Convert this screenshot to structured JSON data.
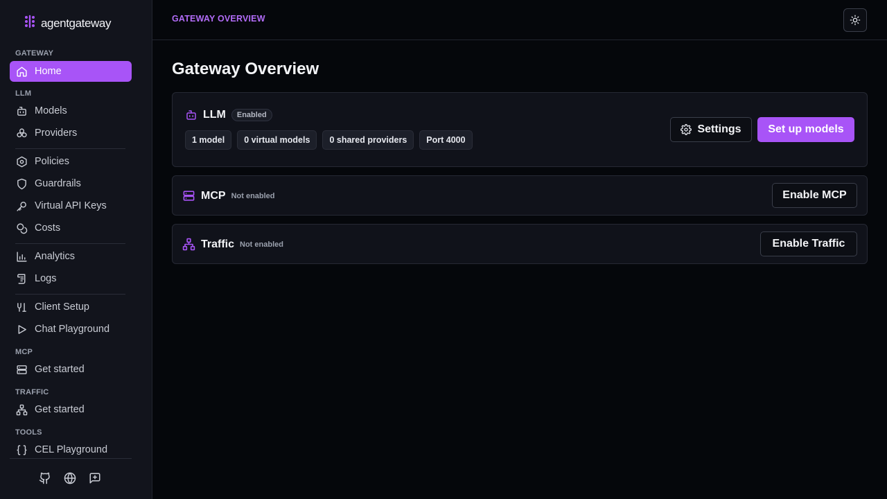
{
  "brand": {
    "name": "agentgateway",
    "accent": "#a854f7"
  },
  "sidebar": {
    "sections": {
      "gateway": "GATEWAY",
      "llm": "LLM",
      "mcp": "MCP",
      "traffic": "TRAFFIC",
      "tools": "TOOLS"
    },
    "items": {
      "home": "Home",
      "models": "Models",
      "providers": "Providers",
      "policies": "Policies",
      "guardrails": "Guardrails",
      "virtual_keys": "Virtual API Keys",
      "costs": "Costs",
      "analytics": "Analytics",
      "logs": "Logs",
      "client_setup": "Client Setup",
      "chat_playground": "Chat Playground",
      "mcp_get_started": "Get started",
      "traffic_get_started": "Get started",
      "cel_playground": "CEL Playground"
    },
    "footer_icons": [
      "github-icon",
      "globe-icon",
      "feedback-icon"
    ]
  },
  "header": {
    "breadcrumb": "GATEWAY OVERVIEW",
    "theme_icon": "sun-icon"
  },
  "main": {
    "title": "Gateway Overview",
    "llm": {
      "name": "LLM",
      "status": "Enabled",
      "chips": [
        "1 model",
        "0 virtual models",
        "0 shared providers",
        "Port 4000"
      ],
      "settings_label": "Settings",
      "setup_label": "Set up models"
    },
    "mcp": {
      "name": "MCP",
      "status": "Not enabled",
      "button_label": "Enable MCP"
    },
    "traffic": {
      "name": "Traffic",
      "status": "Not enabled",
      "button_label": "Enable Traffic"
    }
  }
}
